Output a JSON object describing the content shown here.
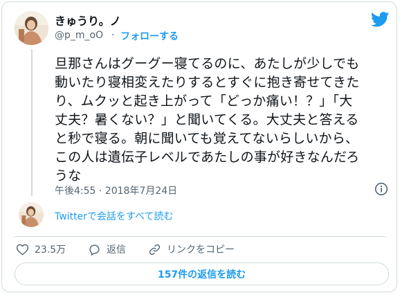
{
  "author": {
    "name": "きゅうり。ノ",
    "handle": "@p_m_oO",
    "separator": "·",
    "follow_label": "フォローする"
  },
  "tweet": {
    "lines": [
      "旦那さんはグーグー寝てるのに、あたしが少しでも",
      "動いたり寝相変えたりするとすぐに抱き寄せてきた",
      "り、ムクッと起き上がって「どっか痛い！？」「大",
      "丈夫？暑くない？」と聞いてくる。大丈夫と答える",
      "と秒で寝る。朝に聞いても覚えてないらしいから、",
      "この人は遺伝子レベルであたしの事が好きなんだろ",
      "うな"
    ],
    "timestamp": "午後4:55 · 2018年7月24日"
  },
  "thread_link": "Twitterで会話をすべて読む",
  "actions": {
    "like_count": "23.5万",
    "reply_label": "返信",
    "copy_link_label": "リンクをコピー"
  },
  "replies_button": "157件の返信を読む",
  "icons": {
    "brand": "twitter-bird-icon",
    "info": "info-icon",
    "like": "heart-icon",
    "reply": "reply-bubble-icon",
    "copy": "link-icon"
  },
  "colors": {
    "accent": "#1d9bf0",
    "text": "#0f1419",
    "muted": "#536471",
    "border": "#cfd9de"
  }
}
